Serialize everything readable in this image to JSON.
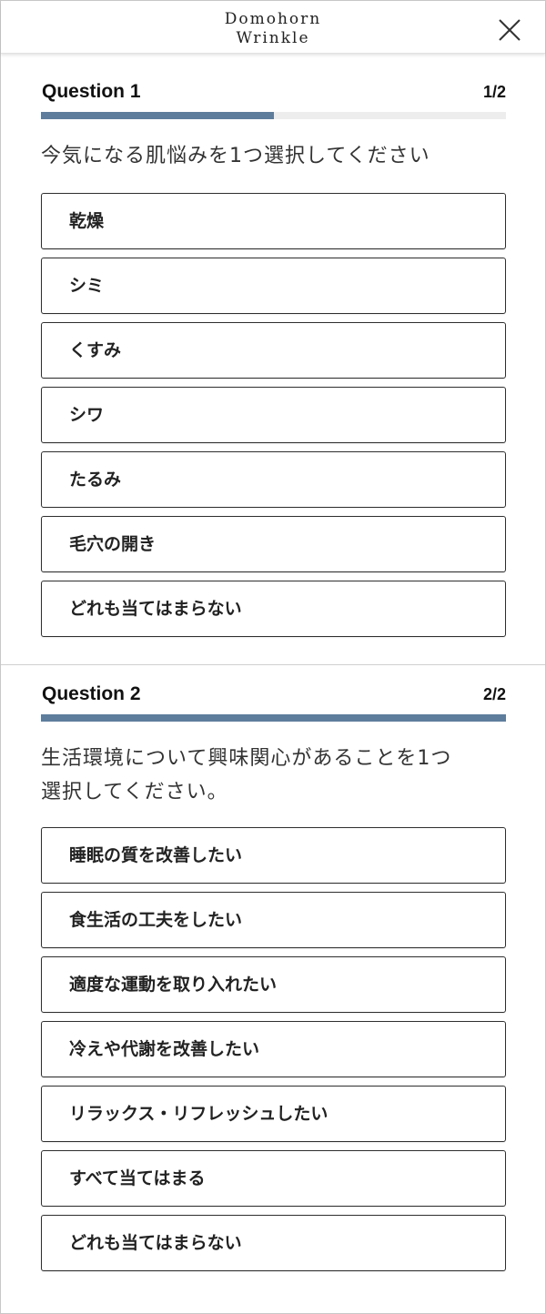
{
  "header": {
    "logo_line1": "Domohorn",
    "logo_line2": "Wrinkle"
  },
  "colors": {
    "accent": "#5e7d9c",
    "track": "#ededed"
  },
  "questions": [
    {
      "title": "Question 1",
      "counter": "1/2",
      "progress": 0.5,
      "prompt": "今気になる肌悩みを1つ選択してください",
      "options": [
        "乾燥",
        "シミ",
        "くすみ",
        "シワ",
        "たるみ",
        "毛穴の開き",
        "どれも当てはまらない"
      ]
    },
    {
      "title": "Question 2",
      "counter": "2/2",
      "progress": 1.0,
      "prompt_line1": "生活環境について興味関心があることを1つ",
      "prompt_line2": "選択してください。",
      "options": [
        "睡眠の質を改善したい",
        "食生活の工夫をしたい",
        "適度な運動を取り入れたい",
        "冷えや代謝を改善したい",
        "リラックス・リフレッシュしたい",
        "すべて当てはまる",
        "どれも当てはまらない"
      ]
    }
  ]
}
